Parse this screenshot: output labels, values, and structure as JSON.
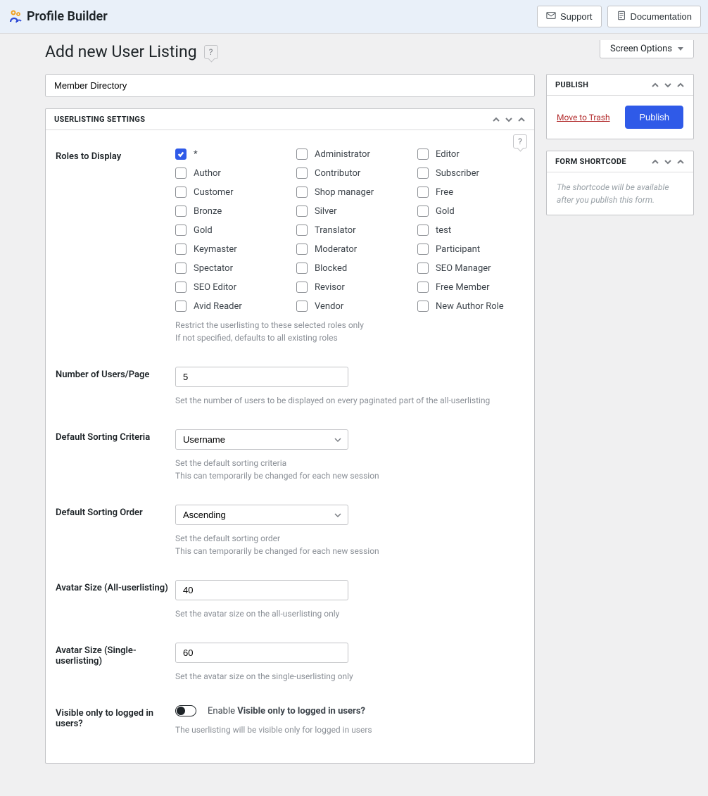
{
  "topbar": {
    "brand": "Profile Builder",
    "support": "Support",
    "documentation": "Documentation"
  },
  "heading": {
    "title": "Add new User Listing",
    "screen_options": "Screen Options"
  },
  "title_input_value": "Member Directory",
  "settings_box": {
    "title": "USERLISTING SETTINGS"
  },
  "roles": {
    "label": "Roles to Display",
    "col1": [
      {
        "label": "*",
        "checked": true
      },
      {
        "label": "Author",
        "checked": false
      },
      {
        "label": "Customer",
        "checked": false
      },
      {
        "label": "Bronze",
        "checked": false
      },
      {
        "label": "Gold",
        "checked": false
      },
      {
        "label": "Keymaster",
        "checked": false
      },
      {
        "label": "Spectator",
        "checked": false
      },
      {
        "label": "SEO Editor",
        "checked": false
      },
      {
        "label": "Avid Reader",
        "checked": false
      }
    ],
    "col2": [
      {
        "label": "Administrator",
        "checked": false
      },
      {
        "label": "Contributor",
        "checked": false
      },
      {
        "label": "Shop manager",
        "checked": false
      },
      {
        "label": "Silver",
        "checked": false
      },
      {
        "label": "Translator",
        "checked": false
      },
      {
        "label": "Moderator",
        "checked": false
      },
      {
        "label": "Blocked",
        "checked": false
      },
      {
        "label": "Revisor",
        "checked": false
      },
      {
        "label": "Vendor",
        "checked": false
      }
    ],
    "col3": [
      {
        "label": "Editor",
        "checked": false
      },
      {
        "label": "Subscriber",
        "checked": false
      },
      {
        "label": "Free",
        "checked": false
      },
      {
        "label": "Gold",
        "checked": false
      },
      {
        "label": "test",
        "checked": false
      },
      {
        "label": "Participant",
        "checked": false
      },
      {
        "label": "SEO Manager",
        "checked": false
      },
      {
        "label": "Free Member",
        "checked": false
      },
      {
        "label": "New Author Role",
        "checked": false
      }
    ],
    "desc1": "Restrict the userlisting to these selected roles only",
    "desc2": "If not specified, defaults to all existing roles"
  },
  "users_per_page": {
    "label": "Number of Users/Page",
    "value": "5",
    "desc": "Set the number of users to be displayed on every paginated part of the all-userlisting"
  },
  "sort_criteria": {
    "label": "Default Sorting Criteria",
    "value": "Username",
    "desc1": "Set the default sorting criteria",
    "desc2": "This can temporarily be changed for each new session"
  },
  "sort_order": {
    "label": "Default Sorting Order",
    "value": "Ascending",
    "desc1": "Set the default sorting order",
    "desc2": "This can temporarily be changed for each new session"
  },
  "avatar_all": {
    "label": "Avatar Size (All-userlisting)",
    "value": "40",
    "desc": "Set the avatar size on the all-userlisting only"
  },
  "avatar_single": {
    "label": "Avatar Size (Single-userlisting)",
    "value": "60",
    "desc": "Set the avatar size on the single-userlisting only"
  },
  "visible": {
    "label": "Visible only to logged in users?",
    "toggle_prefix": "Enable ",
    "toggle_strong": "Visible only to logged in users?",
    "desc": "The userlisting will be visible only for logged in users"
  },
  "publish_box": {
    "title": "PUBLISH",
    "trash": "Move to Trash",
    "publish": "Publish"
  },
  "shortcode_box": {
    "title": "FORM SHORTCODE",
    "msg": "The shortcode will be available after you publish this form."
  }
}
